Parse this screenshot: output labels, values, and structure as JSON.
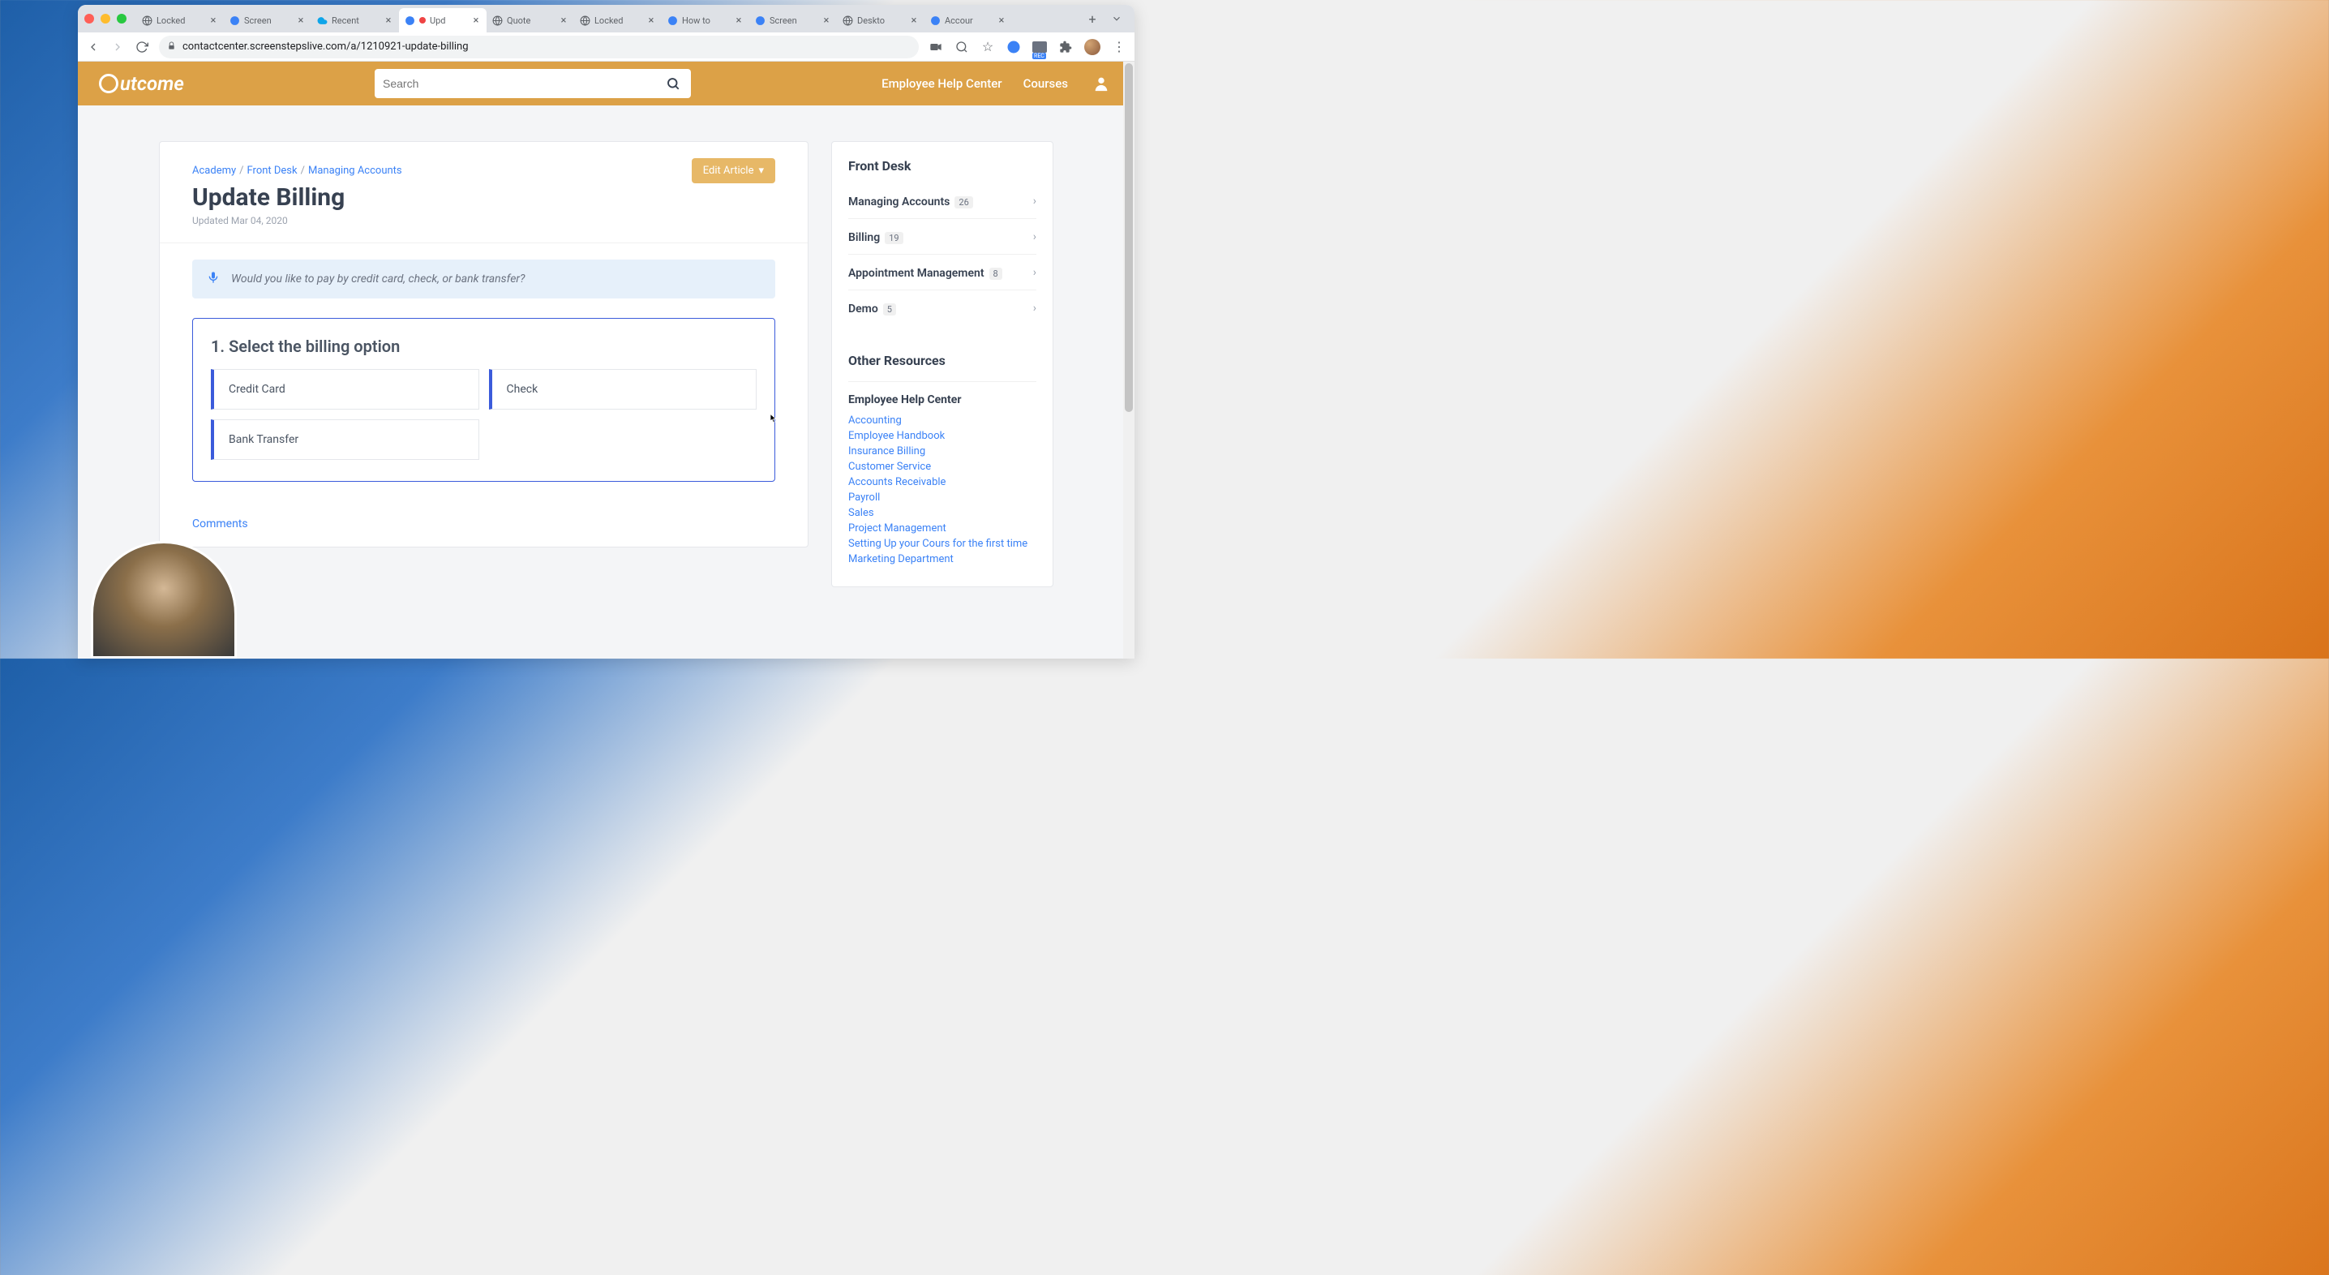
{
  "browser": {
    "url": "contactcenter.screenstepslive.com/a/1210921-update-billing",
    "tabs": [
      {
        "title": "Locked",
        "favicon": "🌐"
      },
      {
        "title": "Screen",
        "favicon": "⬡"
      },
      {
        "title": "Recent",
        "favicon": "☁"
      },
      {
        "title": "Upd",
        "favicon": "⬡",
        "active": true,
        "recording": true
      },
      {
        "title": "Quote",
        "favicon": "🌐"
      },
      {
        "title": "Locked",
        "favicon": "🌐"
      },
      {
        "title": "How to",
        "favicon": "⬡"
      },
      {
        "title": "Screen",
        "favicon": "⬡"
      },
      {
        "title": "Deskto",
        "favicon": "🌐"
      },
      {
        "title": "Accour",
        "favicon": "⬡"
      }
    ]
  },
  "header": {
    "logo": "utcome",
    "search_placeholder": "Search",
    "link_help": "Employee Help Center",
    "link_courses": "Courses"
  },
  "article": {
    "breadcrumbs": [
      "Academy",
      "Front Desk",
      "Managing Accounts"
    ],
    "title": "Update Billing",
    "updated": "Updated Mar 04, 2020",
    "edit_label": "Edit Article",
    "callout": "Would you like to pay by credit card, check, or bank transfer?",
    "step_title": "1. Select the billing option",
    "options": [
      "Credit Card",
      "Check",
      "Bank Transfer"
    ],
    "comments_label": "Comments"
  },
  "sidebar": {
    "heading1": "Front Desk",
    "items": [
      {
        "label": "Managing Accounts",
        "count": "26"
      },
      {
        "label": "Billing",
        "count": "19"
      },
      {
        "label": "Appointment Management",
        "count": "8"
      },
      {
        "label": "Demo",
        "count": "5"
      }
    ],
    "heading2": "Other Resources",
    "subheading": "Employee Help Center",
    "links": [
      "Accounting",
      "Employee Handbook",
      "Insurance Billing",
      "Customer Service",
      "Accounts Receivable",
      "Payroll",
      "Sales",
      "Project Management",
      "Setting Up your Cours for the first time",
      "Marketing Department"
    ]
  }
}
